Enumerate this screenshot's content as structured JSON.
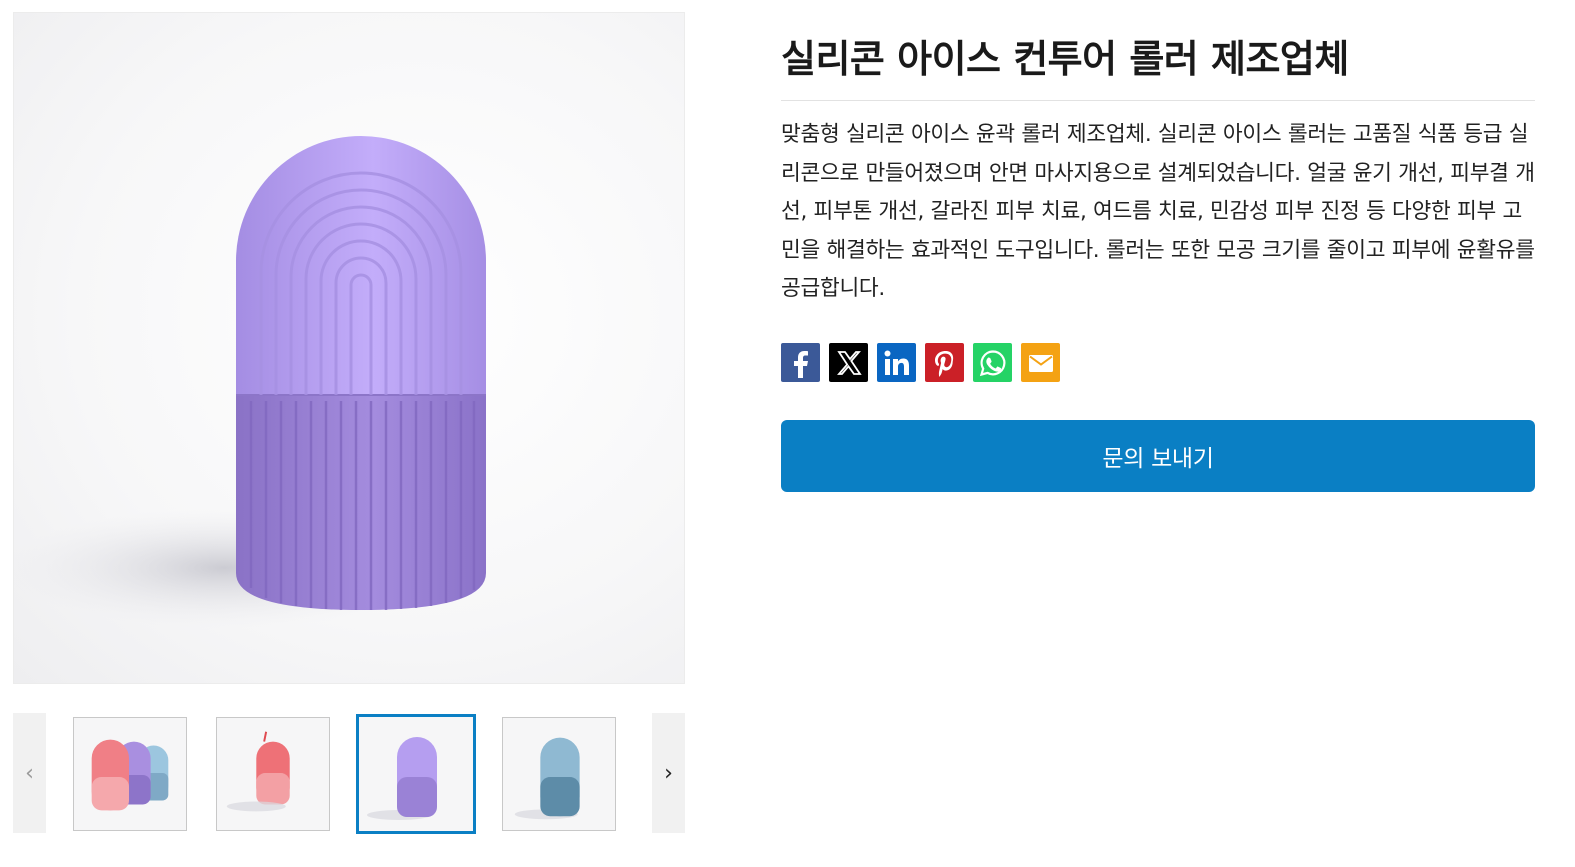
{
  "product": {
    "title": "실리콘 아이스 컨투어 롤러 제조업체",
    "description": "맞춤형 실리콘 아이스 윤곽 롤러 제조업체. 실리콘 아이스 롤러는 고품질 식품 등급 실리콘으로 만들어졌으며 안면 마사지용으로 설계되었습니다. 얼굴 윤기 개선, 피부결 개선, 피부톤 개선, 갈라진 피부 치료, 여드름 치료, 민감성 피부 진정 등 다양한 피부 고민을 해결하는 효과적인 도구입니다. 롤러는 또한 모공 크기를 줄이고 피부에 윤활유를 공급합니다.",
    "inquiry_label": "문의 보내기"
  },
  "gallery": {
    "main_image": "purple-ice-roller-capsule",
    "thumbnails": [
      {
        "name": "three-color-rollers",
        "active": false
      },
      {
        "name": "pink-roller",
        "active": false
      },
      {
        "name": "purple-roller",
        "active": true
      },
      {
        "name": "blue-roller",
        "active": false
      }
    ],
    "prev_icon": "chevron-left-icon",
    "next_icon": "chevron-right-icon"
  },
  "share": [
    {
      "name": "facebook-icon",
      "color": "#3b5998"
    },
    {
      "name": "x-icon",
      "color": "#000000"
    },
    {
      "name": "linkedin-icon",
      "color": "#0a66c2"
    },
    {
      "name": "pinterest-icon",
      "color": "#cb2027"
    },
    {
      "name": "whatsapp-icon",
      "color": "#25d366"
    },
    {
      "name": "email-icon",
      "color": "#f4a213"
    }
  ],
  "colors": {
    "accent": "#0a7fc4",
    "roller_purple_top": "#b9a3f2",
    "roller_purple_bottom": "#9a82d6"
  }
}
